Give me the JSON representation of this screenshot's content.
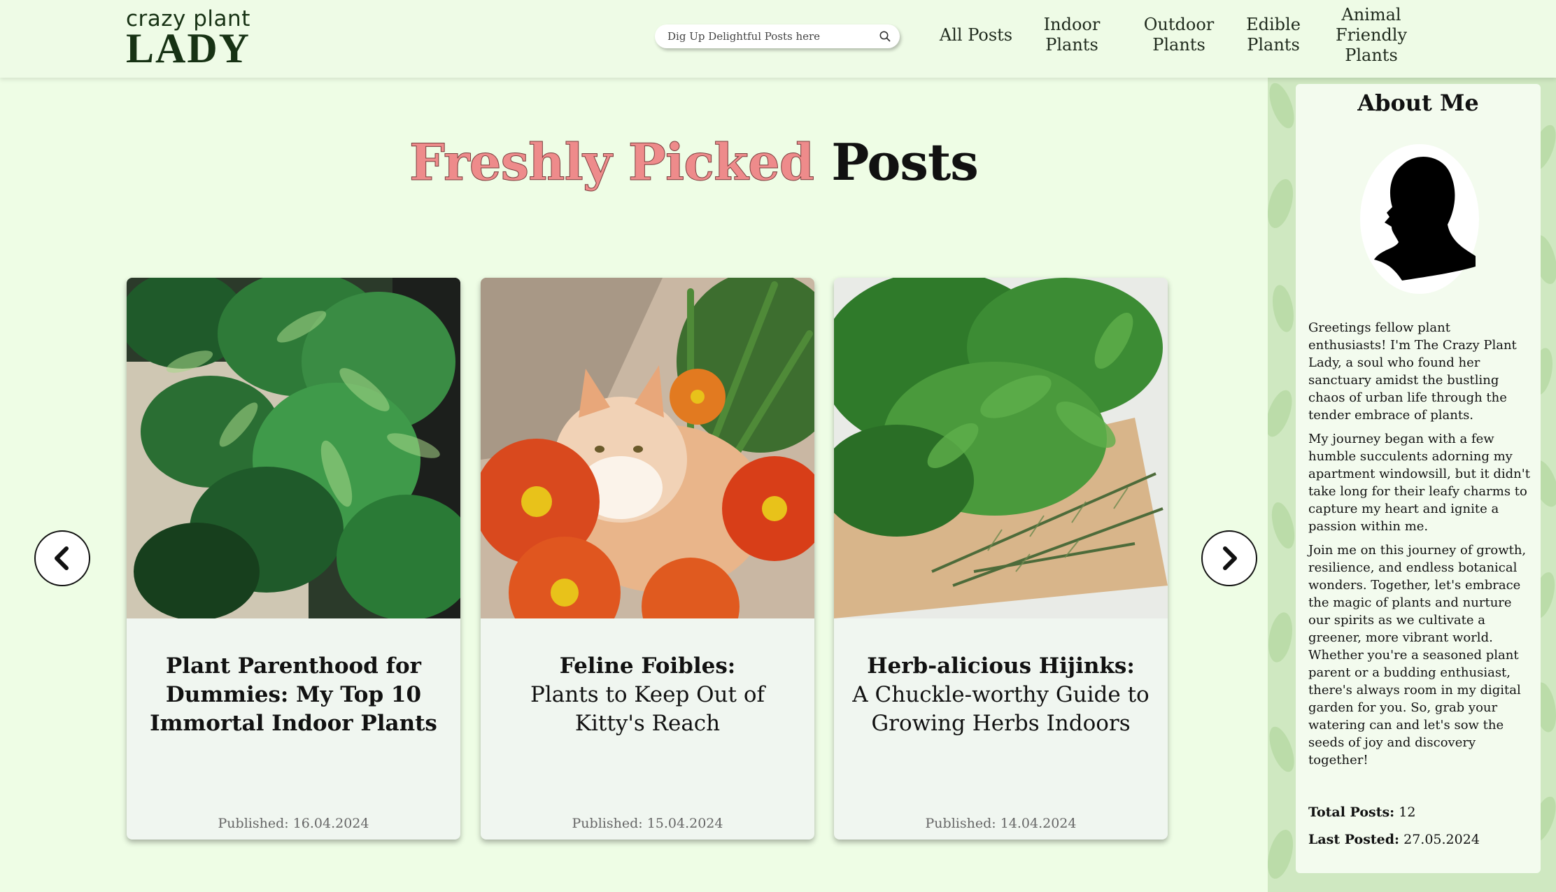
{
  "header": {
    "logo_small": "crazy plant",
    "logo_big": "LADY",
    "search_placeholder": "Dig Up Delightful Posts here",
    "nav": [
      {
        "label": "All Posts"
      },
      {
        "label": "Indoor\nPlants"
      },
      {
        "label": "Outdoor\nPlants"
      },
      {
        "label": "Edible\nPlants"
      },
      {
        "label": "Animal\nFriendly\nPlants"
      }
    ]
  },
  "main": {
    "headline_accent": "Freshly Picked",
    "headline_rest": "Posts",
    "cards": [
      {
        "title_line1": "Plant Parenthood for",
        "title_line2": "Dummies: My Top 10 Immortal Indoor Plants",
        "date": "Published: 16.04.2024"
      },
      {
        "title_line1": "Feline Foibles:",
        "title_line2": "Plants to Keep Out of Kitty's Reach",
        "date": "Published: 15.04.2024"
      },
      {
        "title_line1": "Herb-alicious Hijinks:",
        "title_line2": "A Chuckle-worthy Guide to Growing Herbs Indoors",
        "date": "Published: 14.04.2024"
      }
    ]
  },
  "sidebar": {
    "title": "About Me",
    "paragraphs": [
      "Greetings fellow plant enthusiasts! I'm The Crazy Plant Lady, a soul who found her sanctuary amidst the bustling chaos of urban life through the tender embrace of plants.",
      "My journey began with a few humble succulents adorning my apartment windowsill, but it didn't take long for their leafy charms to capture my heart and ignite a passion within me.",
      "Join me on this journey of growth, resilience, and endless botanical wonders. Together, let's embrace the magic of plants and nurture our spirits as we cultivate a greener, more vibrant world. Whether you're a seasoned plant parent or a budding enthusiast, there's always room in my digital garden for you. So, grab your watering can and let's sow the seeds of joy and discovery together!"
    ],
    "total_posts_label": "Total Posts:",
    "total_posts_value": "12",
    "last_posted_label": "Last Posted:",
    "last_posted_value": "27.05.2024"
  },
  "colors": {
    "background": "#eefde5",
    "accent_pink": "#ee8b8b",
    "logo_green": "#173214",
    "sidebar_green": "#cfe8c1"
  },
  "icons": {
    "search": "search-icon",
    "prev": "chevron-left-icon",
    "next": "chevron-right-icon",
    "avatar": "woman-silhouette-icon"
  }
}
